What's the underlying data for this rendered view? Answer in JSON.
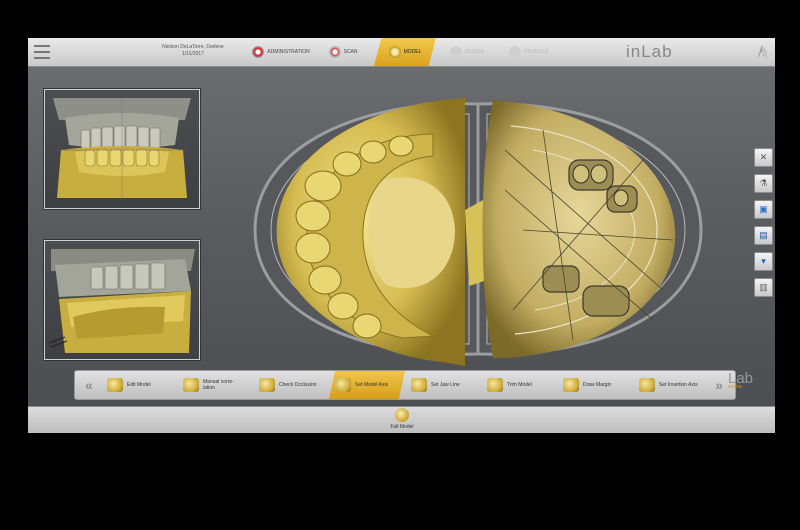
{
  "header": {
    "patient_name": "Nielson DeLaTorre, Darlene",
    "patient_date": "1/11/2017",
    "brand": "inLab",
    "phases": [
      {
        "label": "ADMINISTRATION",
        "state": "done",
        "icon": "administration-icon"
      },
      {
        "label": "SCAN",
        "state": "done",
        "icon": "scan-icon"
      },
      {
        "label": "MODEL",
        "state": "active",
        "icon": "model-icon"
      },
      {
        "label": "DESIGN",
        "state": "disabled",
        "icon": "design-icon"
      },
      {
        "label": "PRODUCE",
        "state": "disabled",
        "icon": "produce-icon"
      }
    ]
  },
  "side_tools": [
    {
      "icon": "tools-icon"
    },
    {
      "icon": "analysis-icon"
    },
    {
      "icon": "view-options-icon"
    },
    {
      "icon": "model-tree-icon"
    },
    {
      "icon": "save-icon"
    },
    {
      "icon": "catalog-icon"
    }
  ],
  "steps": [
    {
      "label": "Edit Model",
      "state": "normal"
    },
    {
      "label": "Manual corre-\nlation",
      "state": "normal"
    },
    {
      "label": "Check Occlusion",
      "state": "normal"
    },
    {
      "label": "Set Model Axis",
      "state": "active"
    },
    {
      "label": "Set Jaw Line",
      "state": "normal"
    },
    {
      "label": "Trim Model",
      "state": "normal"
    },
    {
      "label": "Draw Margin",
      "state": "normal"
    },
    {
      "label": "Set Insertion Axis",
      "state": "normal"
    }
  ],
  "nav": {
    "prev": "«",
    "next": "»"
  },
  "vendor": {
    "lab": "Lab",
    "name": "sirona"
  },
  "bottom": {
    "full_model_label": "Full Model"
  },
  "colors": {
    "accent": "#e3b02e",
    "model_yellow": "#d8c36a",
    "background": "#5c5e61"
  }
}
